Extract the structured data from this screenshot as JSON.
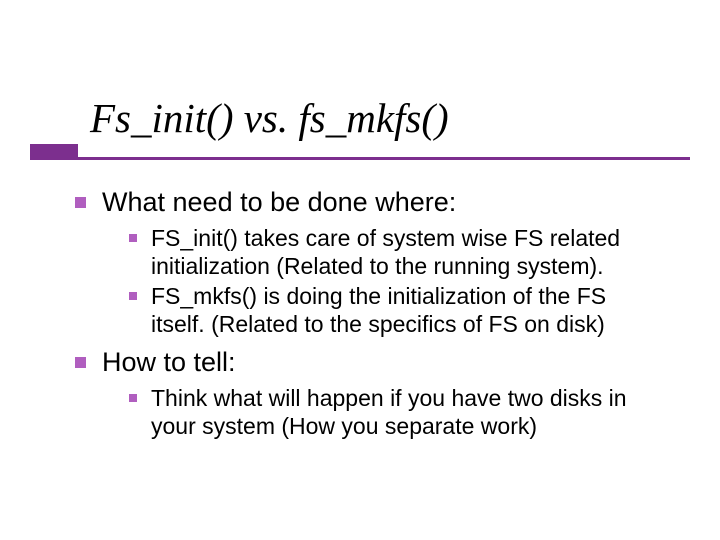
{
  "title": "Fs_init() vs. fs_mkfs()",
  "colors": {
    "accent": "#7c2f8e",
    "bullet": "#b05ebf",
    "text": "#000000",
    "background": "#ffffff"
  },
  "sections": [
    {
      "heading": "What need to be done where:",
      "items": [
        "FS_init() takes care of system wise FS related initialization (Related to the running system).",
        "FS_mkfs() is doing the initialization of the FS itself. (Related to the specifics of FS on disk)"
      ]
    },
    {
      "heading": "How to tell:",
      "items": [
        "Think what will happen if you have two disks in your system (How you separate work)"
      ]
    }
  ]
}
